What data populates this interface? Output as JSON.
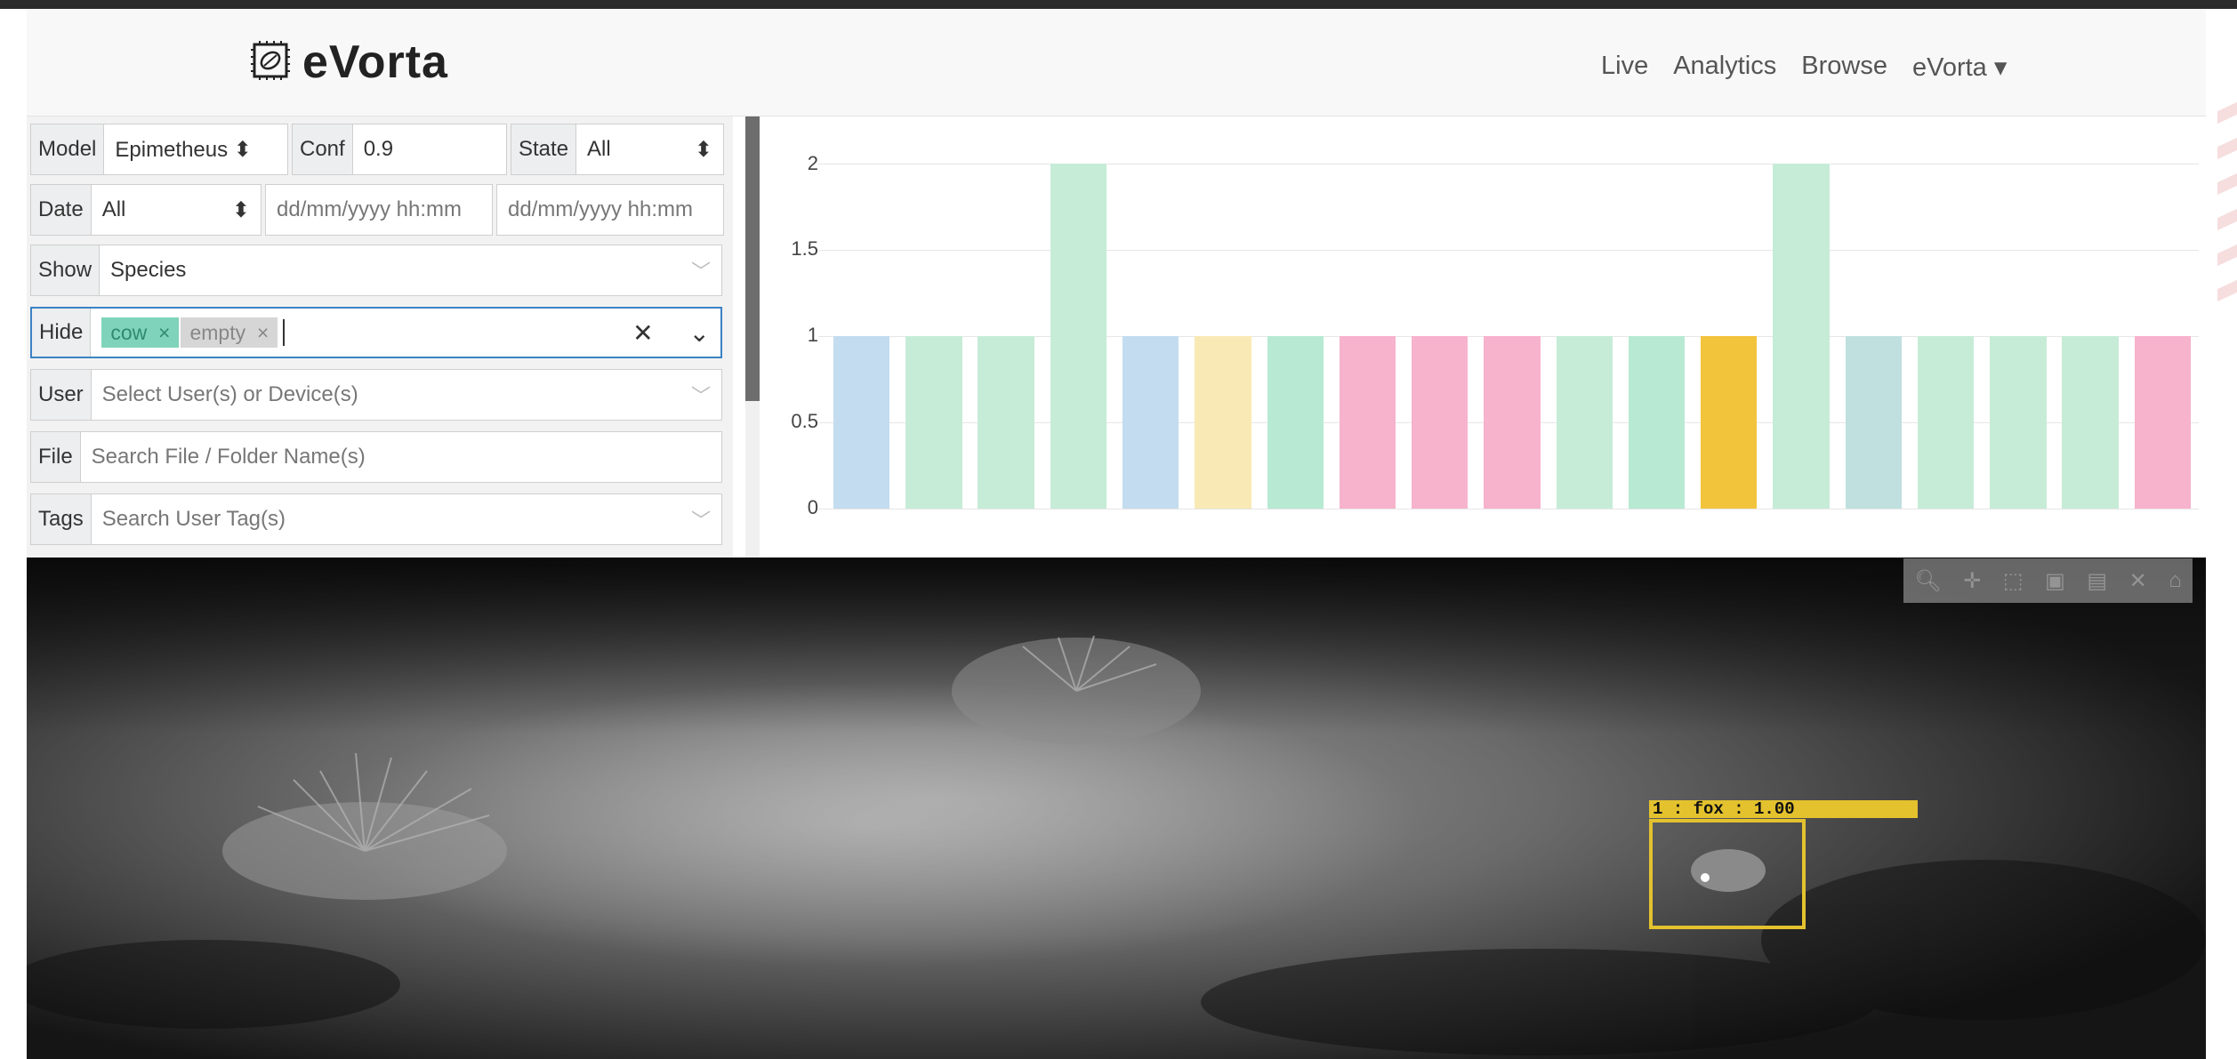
{
  "brand": {
    "name": "eVorta"
  },
  "nav": {
    "live": "Live",
    "analytics": "Analytics",
    "browse": "Browse",
    "account": "eVorta ▾"
  },
  "filters": {
    "model": {
      "label": "Model",
      "value": "Epimetheus ⬍"
    },
    "conf": {
      "label": "Conf",
      "value": "0.9"
    },
    "state": {
      "label": "State",
      "value": "All"
    },
    "date": {
      "label": "Date",
      "value": "All",
      "from_placeholder": "dd/mm/yyyy hh:mm",
      "to_placeholder": "dd/mm/yyyy hh:mm"
    },
    "show": {
      "label": "Show",
      "value": "Species"
    },
    "hide": {
      "label": "Hide",
      "tags": [
        "cow",
        "empty"
      ],
      "clear": "✕"
    },
    "user": {
      "label": "User",
      "placeholder": "Select User(s) or Device(s)"
    },
    "file": {
      "label": "File",
      "placeholder": "Search File / Folder Name(s)"
    },
    "tags": {
      "label": "Tags",
      "placeholder": "Search User Tag(s)"
    }
  },
  "chart_data": {
    "type": "bar",
    "yticks": [
      "2",
      "1.5",
      "1",
      "0.5",
      "0"
    ],
    "ylim": [
      0,
      2
    ],
    "values": [
      1,
      1,
      1,
      2,
      1,
      1,
      1,
      1,
      1,
      1,
      1,
      1,
      1,
      2,
      1,
      1,
      1,
      1,
      1
    ],
    "colors": [
      "#c3dcef",
      "#c6ecd7",
      "#c6ecd7",
      "#c6ecd7",
      "#c3dcef",
      "#f9e9b5",
      "#b7e9d3",
      "#f7b2cc",
      "#f7b2cc",
      "#f7b2cc",
      "#c6ecd7",
      "#b7e9d3",
      "#f2c43c",
      "#c6ecd7",
      "#bfe0de",
      "#c6ecd7",
      "#c6ecd7",
      "#c6ecd7",
      "#f7b2cc"
    ]
  },
  "detection": {
    "label": "1 : fox : 1.00"
  },
  "modebar": {
    "icons": [
      "zoom-icon",
      "pan-icon",
      "select-icon",
      "download-icon",
      "save-icon",
      "close-icon",
      "home-icon"
    ]
  }
}
